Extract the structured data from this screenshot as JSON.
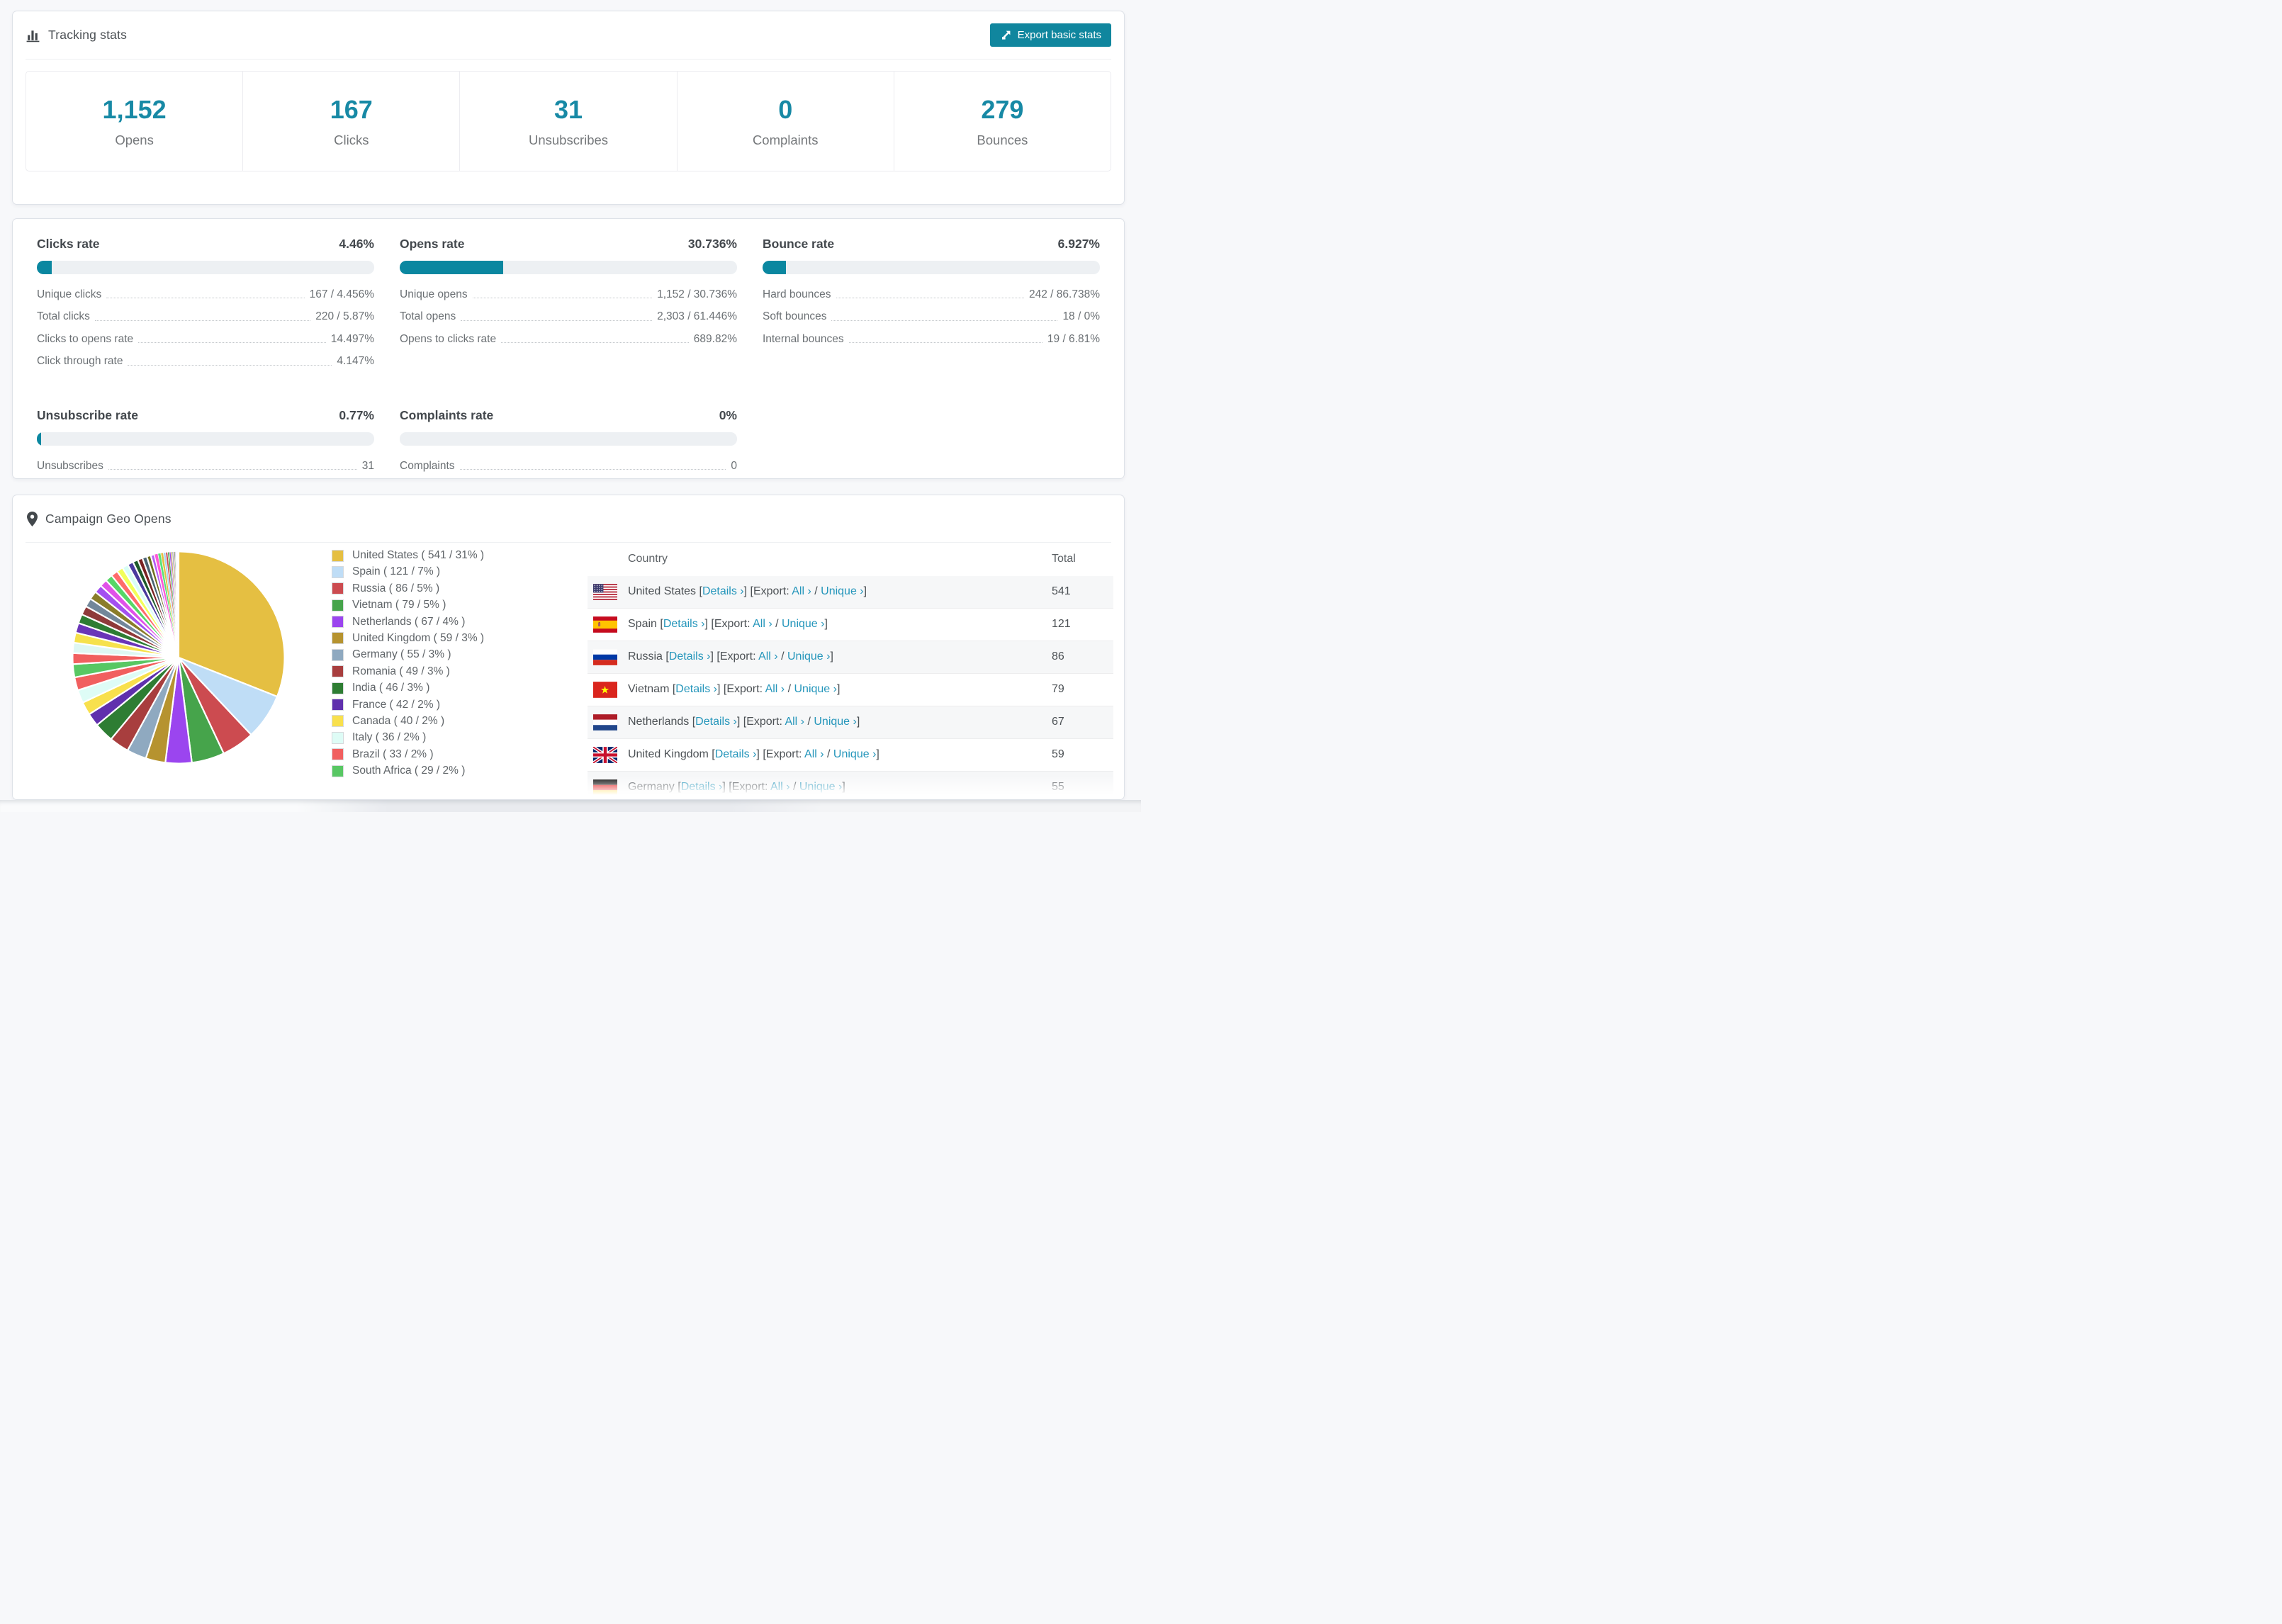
{
  "colors": {
    "accent_teal": "#10869e",
    "progress_fill": "#0a87a0",
    "stat_number": "#1789a5",
    "link": "#2596bb",
    "page_bg": "#f7f8fa",
    "row_alt_bg": "#f6f7f8"
  },
  "tracking": {
    "icon": "bar-chart-icon",
    "title": "Tracking stats",
    "export_button": "Export basic stats",
    "export_button_icon": "export-icon",
    "stats": [
      {
        "value": "1,152",
        "label": "Opens"
      },
      {
        "value": "167",
        "label": "Clicks"
      },
      {
        "value": "31",
        "label": "Unsubscribes"
      },
      {
        "value": "0",
        "label": "Complaints"
      },
      {
        "value": "279",
        "label": "Bounces"
      }
    ]
  },
  "rates": {
    "blocks": [
      {
        "title": "Clicks rate",
        "value": "4.46%",
        "pct": 4.46,
        "rows": [
          [
            "Unique clicks",
            "167 / 4.456%"
          ],
          [
            "Total clicks",
            "220 / 5.87%"
          ],
          [
            "Clicks to opens rate",
            "14.497%"
          ],
          [
            "Click through rate",
            "4.147%"
          ]
        ]
      },
      {
        "title": "Opens rate",
        "value": "30.736%",
        "pct": 30.736,
        "rows": [
          [
            "Unique opens",
            "1,152 / 30.736%"
          ],
          [
            "Total opens",
            "2,303 / 61.446%"
          ],
          [
            "Opens to clicks rate",
            "689.82%"
          ]
        ]
      },
      {
        "title": "Bounce rate",
        "value": "6.927%",
        "pct": 6.927,
        "rows": [
          [
            "Hard bounces",
            "242 / 86.738%"
          ],
          [
            "Soft bounces",
            "18 / 0%"
          ],
          [
            "Internal bounces",
            "19 / 6.81%"
          ]
        ]
      },
      {
        "title": "Unsubscribe rate",
        "value": "0.77%",
        "pct": 0.77,
        "rows": [
          [
            "Unsubscribes",
            "31"
          ]
        ]
      },
      {
        "title": "Complaints rate",
        "value": "0%",
        "pct": 0,
        "rows": [
          [
            "Complaints",
            "0"
          ]
        ]
      }
    ]
  },
  "geo": {
    "icon": "map-pin-icon",
    "title": "Campaign Geo Opens",
    "chart_data": {
      "type": "pie",
      "title": "Campaign Geo Opens",
      "legend_position": "right",
      "start_angle_deg": -90,
      "direction": "clockwise",
      "series": [
        {
          "name": "United States",
          "count": 541,
          "pct": 31,
          "color": "#e5bf42"
        },
        {
          "name": "Spain",
          "count": 121,
          "pct": 7,
          "color": "#bfddf6"
        },
        {
          "name": "Russia",
          "count": 86,
          "pct": 5,
          "color": "#cc4b50"
        },
        {
          "name": "Vietnam",
          "count": 79,
          "pct": 5,
          "color": "#46a44b"
        },
        {
          "name": "Netherlands",
          "count": 67,
          "pct": 4,
          "color": "#9b45ef"
        },
        {
          "name": "United Kingdom",
          "count": 59,
          "pct": 3,
          "color": "#b6932f"
        },
        {
          "name": "Germany",
          "count": 55,
          "pct": 3,
          "color": "#8fa9c0"
        },
        {
          "name": "Romania",
          "count": 49,
          "pct": 3,
          "color": "#a83e3e"
        },
        {
          "name": "India",
          "count": 46,
          "pct": 3,
          "color": "#2e7d33"
        },
        {
          "name": "France",
          "count": 42,
          "pct": 2,
          "color": "#6030ad"
        },
        {
          "name": "Canada",
          "count": 40,
          "pct": 2,
          "color": "#f8e04d"
        },
        {
          "name": "Italy",
          "count": 36,
          "pct": 2,
          "color": "#defcf6"
        },
        {
          "name": "Brazil",
          "count": 33,
          "pct": 2,
          "color": "#f15f5f"
        },
        {
          "name": "South Africa",
          "count": 29,
          "pct": 2,
          "color": "#58c763"
        }
      ],
      "others": {
        "total_pct": 26,
        "slice_pcts_approx": [
          1.9,
          1.8,
          1.75,
          1.7,
          1.6,
          1.55,
          1.5,
          1.45,
          1.4,
          1.3,
          1.25,
          1.2,
          1.1,
          1.05,
          1.0,
          0.9,
          0.85,
          0.8,
          0.7,
          0.65,
          0.6,
          0.5,
          0.45,
          0.4,
          0.35,
          0.3,
          0.25,
          0.22,
          0.2,
          0.18,
          0.15,
          0.12,
          0.1,
          0.08,
          0.07,
          0.06,
          0.05,
          0.04,
          0.03,
          0.03
        ],
        "palette": [
          "#f15f5f",
          "#def7f3",
          "#f6e14c",
          "#6a35b8",
          "#2e7d33",
          "#8f3a3a",
          "#72879a",
          "#8a7d2a",
          "#a34ff0",
          "#e052e8",
          "#57d667",
          "#ff6b6b",
          "#f2ff59",
          "#d8fff6",
          "#4a3a9e",
          "#1e5a2a",
          "#7a2222",
          "#4a6272",
          "#6e6e1d",
          "#b65cf5",
          "#ff59d6",
          "#59e07a",
          "#e5bf42",
          "#a8d2f0",
          "#cc4b50",
          "#46a44b",
          "#9b45ef",
          "#b6932f",
          "#8fa9c0",
          "#a83e3e",
          "#2e7d33",
          "#6030ad",
          "#f8e04d",
          "#defcf6",
          "#f15f5f",
          "#58c763",
          "#e3b0ff",
          "#ffd6a8",
          "#b0c8ff",
          "#c8ffb0"
        ]
      }
    },
    "legend_format": "{name} ( {count} / {pct}% )",
    "table": {
      "headers": [
        "Country",
        "Total"
      ],
      "links": {
        "details": "Details ›",
        "export": "Export:",
        "all": "All ›",
        "unique": "Unique ›"
      },
      "syntax": {
        "lb": "[",
        "rb": "]",
        "slash": "/"
      },
      "rows": [
        {
          "country": "United States",
          "flag": "us",
          "total": "541"
        },
        {
          "country": "Spain",
          "flag": "es",
          "total": "121"
        },
        {
          "country": "Russia",
          "flag": "ru",
          "total": "86"
        },
        {
          "country": "Vietnam",
          "flag": "vn",
          "total": "79"
        },
        {
          "country": "Netherlands",
          "flag": "nl",
          "total": "67"
        },
        {
          "country": "United Kingdom",
          "flag": "gb",
          "total": "59"
        },
        {
          "country": "Germany",
          "flag": "de",
          "total": "55",
          "partial": true
        }
      ]
    }
  }
}
